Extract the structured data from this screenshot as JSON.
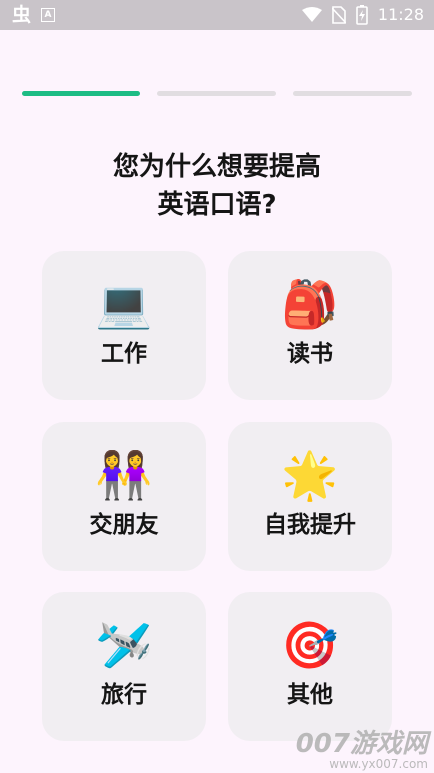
{
  "status_bar": {
    "app_glyph": "虫",
    "notif_letter": "A",
    "time": "11:28",
    "icons": [
      "wifi-icon",
      "no-sim-icon",
      "battery-charging-icon"
    ]
  },
  "progress": {
    "total_steps": 3,
    "current_step": 1,
    "active_color": "#1dbc84",
    "inactive_color": "#e1dde1"
  },
  "question": {
    "line1": "您为什么想要提高",
    "line2": "英语口语?"
  },
  "options": [
    {
      "emoji": "💻",
      "icon": "laptop-icon",
      "label": "工作"
    },
    {
      "emoji": "🎒",
      "icon": "backpack-icon",
      "label": "读书"
    },
    {
      "emoji": "👭",
      "icon": "two-friends-icon",
      "label": "交朋友"
    },
    {
      "emoji": "🌟",
      "icon": "glowing-star-icon",
      "label": "自我提升"
    },
    {
      "emoji": "🛩️",
      "icon": "airplane-icon",
      "label": "旅行"
    },
    {
      "emoji": "🎯",
      "icon": "target-dart-icon",
      "label": "其他"
    }
  ],
  "watermark": {
    "main": "007游戏网",
    "url": "www.yx007.com"
  }
}
